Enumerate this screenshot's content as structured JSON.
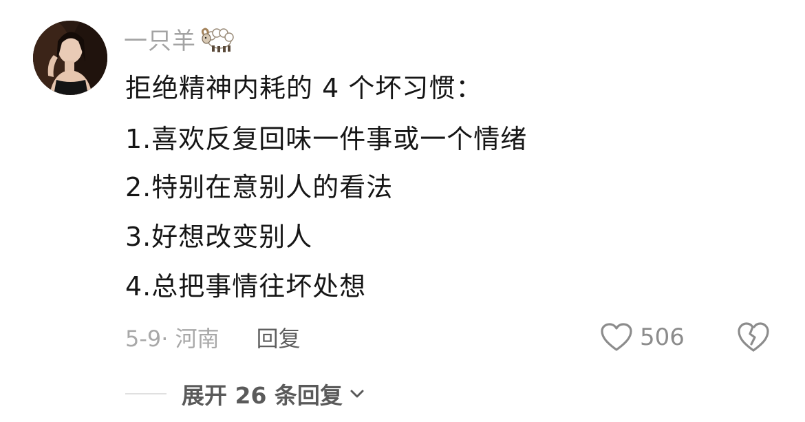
{
  "comment": {
    "username": "一只羊",
    "username_emoji": "sheep-icon",
    "lines": [
      "拒绝精神内耗的 4 个坏习惯：",
      "1.喜欢反复回味一件事或一个情绪",
      "2.特别在意别人的看法",
      "3.好想改变别人",
      "4.总把事情往坏处想"
    ],
    "meta": {
      "date_location": "5-9· 河南",
      "reply_label": "回复"
    },
    "like_count": "506",
    "expand_label": "展开 26 条回复"
  },
  "colors": {
    "text": "#161616",
    "muted": "#a8a8a8",
    "action": "#5a5a5a",
    "icon": "#8c8c8c"
  }
}
